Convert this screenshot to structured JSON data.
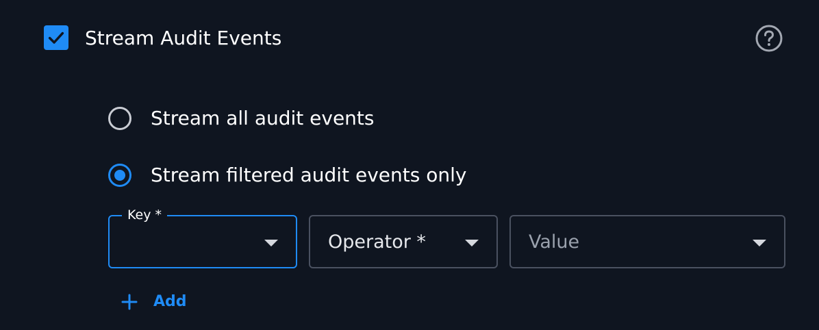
{
  "stream": {
    "checkbox_label": "Stream Audit Events",
    "checked": true,
    "help_icon": "question-circle-icon"
  },
  "options": [
    {
      "label": "Stream all audit events",
      "selected": false
    },
    {
      "label": "Stream filtered audit events only",
      "selected": true
    }
  ],
  "filter": {
    "key": {
      "label": "Key *",
      "value": ""
    },
    "operator": {
      "placeholder": "Operator *"
    },
    "value": {
      "placeholder": "Value"
    }
  },
  "add": {
    "label": "Add",
    "icon": "plus-icon"
  },
  "colors": {
    "background": "#0f1520",
    "accent": "#1f8bf5",
    "border": "#4a5160"
  }
}
